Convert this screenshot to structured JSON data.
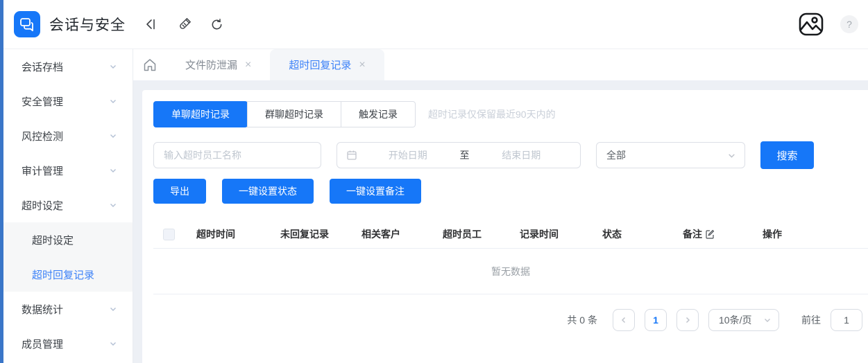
{
  "app_title": "会话与安全",
  "colors": {
    "primary": "#1677f8",
    "left_strip": "#3a76c8",
    "content_background": "#edf0f5",
    "active_link": "#3d82f8"
  },
  "icons": {
    "close": "×",
    "help": "?"
  },
  "sidebar": {
    "items": [
      {
        "label": "会话存档"
      },
      {
        "label": "安全管理"
      },
      {
        "label": "风控检测"
      },
      {
        "label": "审计管理"
      },
      {
        "label": "超时设定"
      },
      {
        "label": "数据统计"
      },
      {
        "label": "成员管理"
      }
    ],
    "submenu": {
      "parent": "超时设定",
      "items": [
        {
          "label": "超时设定",
          "active": false
        },
        {
          "label": "超时回复记录",
          "active": true
        }
      ]
    }
  },
  "tabbar": {
    "tabs": [
      {
        "label": "文件防泄漏",
        "active": false
      },
      {
        "label": "超时回复记录",
        "active": true
      }
    ]
  },
  "filters": {
    "record_tabs": [
      {
        "label": "单聊超时记录",
        "active": true
      },
      {
        "label": "群聊超时记录",
        "active": false
      },
      {
        "label": "触发记录",
        "active": false
      }
    ],
    "retention_note": "超时记录仅保留最近90天内的",
    "name_input_placeholder": "输入超时员工名称",
    "date_start_placeholder": "开始日期",
    "date_separator": "至",
    "date_end_placeholder": "结束日期",
    "status_select_value": "全部",
    "search_button": "搜索"
  },
  "actions": {
    "export": "导出",
    "batch_status": "一键设置状态",
    "batch_remark": "一键设置备注"
  },
  "table": {
    "headers": [
      "超时时间",
      "未回复记录",
      "相关客户",
      "超时员工",
      "记录时间",
      "状态",
      "备注",
      "操作"
    ],
    "empty_text": "暂无数据",
    "rows": []
  },
  "pagination": {
    "total_text": "共 0 条",
    "current_page": "1",
    "page_size": "10条/页",
    "goto_label": "前往",
    "goto_value": "1"
  }
}
